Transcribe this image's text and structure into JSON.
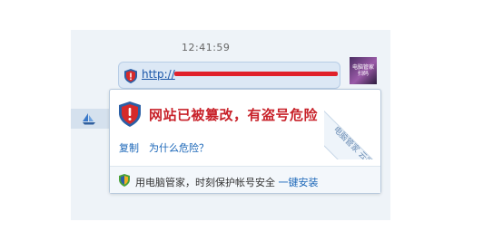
{
  "chat": {
    "timestamp": "12:41:59",
    "link_text": "http://"
  },
  "avatar": {
    "label": "电脑管家 扫码"
  },
  "warning": {
    "title": "网站已被篡改，有盗号危险",
    "copy_label": "复制",
    "why_label": "为什么危险？",
    "ribbon_label": "电脑管家 云鉴定"
  },
  "footer": {
    "text": "用电脑管家，时刻保护帐号安全",
    "install_label": "一键安装"
  },
  "colors": {
    "danger_red": "#c8222a",
    "link_blue": "#1a66b8",
    "shield_red": "#d62a2a",
    "shield_blue": "#2b5fa6",
    "shield_green": "#4aa23a",
    "shield_yellow": "#f0b020"
  }
}
